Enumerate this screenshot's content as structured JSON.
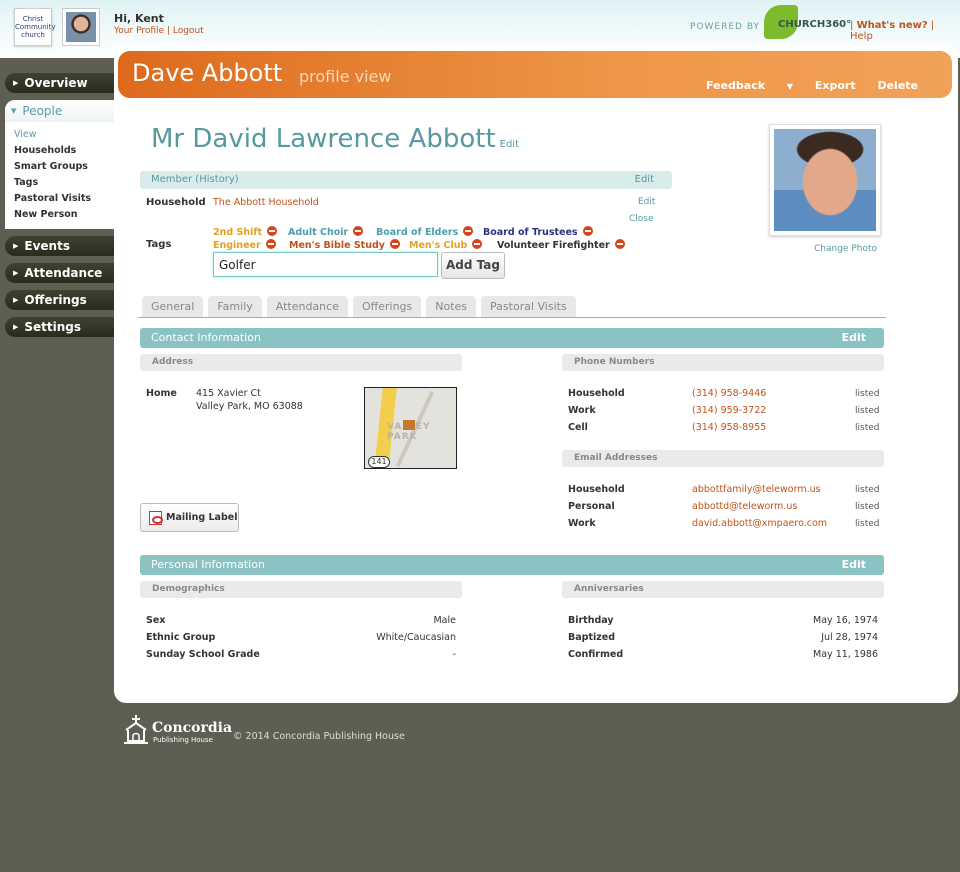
{
  "header": {
    "church_logo_text": "Christ Community church",
    "greeting": "Hi, Kent",
    "your_profile": "Your Profile",
    "separator": "|",
    "logout": "Logout",
    "powered_by": "POWERED BY",
    "brand": "CHURCH360°",
    "whats_new": "What's new?",
    "help": "Help"
  },
  "sidebar": {
    "overview": "Overview",
    "people": "People",
    "people_items": [
      "View",
      "Households",
      "Smart Groups",
      "Tags",
      "Pastoral Visits",
      "New Person"
    ],
    "events": "Events",
    "attendance": "Attendance",
    "offerings": "Offerings",
    "settings": "Settings"
  },
  "banner": {
    "name": "Dave Abbott",
    "subtitle": "profile view",
    "feedback": "Feedback",
    "export": "Export",
    "delete": "Delete"
  },
  "profile": {
    "full_name": "Mr David Lawrence Abbott",
    "edit": "Edit",
    "change_photo": "Change Photo",
    "member_status": "Member (History)",
    "member_edit": "Edit",
    "household_label": "Household",
    "household_value": "The Abbott Household",
    "household_edit": "Edit",
    "tags_close": "Close",
    "tags_label": "Tags",
    "tags": [
      {
        "name": "2nd Shift",
        "color": "#e6a020"
      },
      {
        "name": "Adult Choir",
        "color": "#4a9eb0"
      },
      {
        "name": "Board of Elders",
        "color": "#4a9eb0"
      },
      {
        "name": "Board of Trustees",
        "color": "#2b3480"
      },
      {
        "name": "Engineer",
        "color": "#e6a020"
      },
      {
        "name": "Men's Bible Study",
        "color": "#c0531b"
      },
      {
        "name": "Men's Club",
        "color": "#e6a020"
      },
      {
        "name": "Volunteer Firefighter",
        "color": "#333333"
      }
    ],
    "tag_input_value": "Golfer",
    "add_tag": "Add Tag"
  },
  "tabs": [
    "General",
    "Family",
    "Attendance",
    "Offerings",
    "Notes",
    "Pastoral Visits"
  ],
  "contact": {
    "title": "Contact Information",
    "edit": "Edit",
    "address_header": "Address",
    "home_label": "Home",
    "street": "415 Xavier Ct",
    "city": "Valley Park, MO 63088",
    "map_text": "VALLEY PARK",
    "map_route": "141",
    "mailing_label": "Mailing Label",
    "phone_header": "Phone Numbers",
    "phones": [
      {
        "label": "Household",
        "value": "(314) 958-9446",
        "status": "listed"
      },
      {
        "label": "Work",
        "value": "(314) 959-3722",
        "status": "listed"
      },
      {
        "label": "Cell",
        "value": "(314) 958-8955",
        "status": "listed"
      }
    ],
    "email_header": "Email Addresses",
    "emails": [
      {
        "label": "Household",
        "value": "abbottfamily@teleworm.us",
        "status": "listed"
      },
      {
        "label": "Personal",
        "value": "abbottd@teleworm.us",
        "status": "listed"
      },
      {
        "label": "Work",
        "value": "david.abbott@xmpaero.com",
        "status": "listed"
      }
    ]
  },
  "personal": {
    "title": "Personal Information",
    "edit": "Edit",
    "demographics_header": "Demographics",
    "demographics": [
      {
        "label": "Sex",
        "value": "Male"
      },
      {
        "label": "Ethnic Group",
        "value": "White/Caucasian"
      },
      {
        "label": "Sunday School Grade",
        "value": "-"
      }
    ],
    "anniversaries_header": "Anniversaries",
    "anniversaries": [
      {
        "label": "Birthday",
        "value": "May 16, 1974"
      },
      {
        "label": "Baptized",
        "value": "Jul 28, 1974"
      },
      {
        "label": "Confirmed",
        "value": "May 11, 1986"
      }
    ]
  },
  "footer": {
    "logo_name": "Concordia",
    "logo_sub": "Publishing House",
    "copyright": "© 2014 Concordia Publishing House"
  }
}
